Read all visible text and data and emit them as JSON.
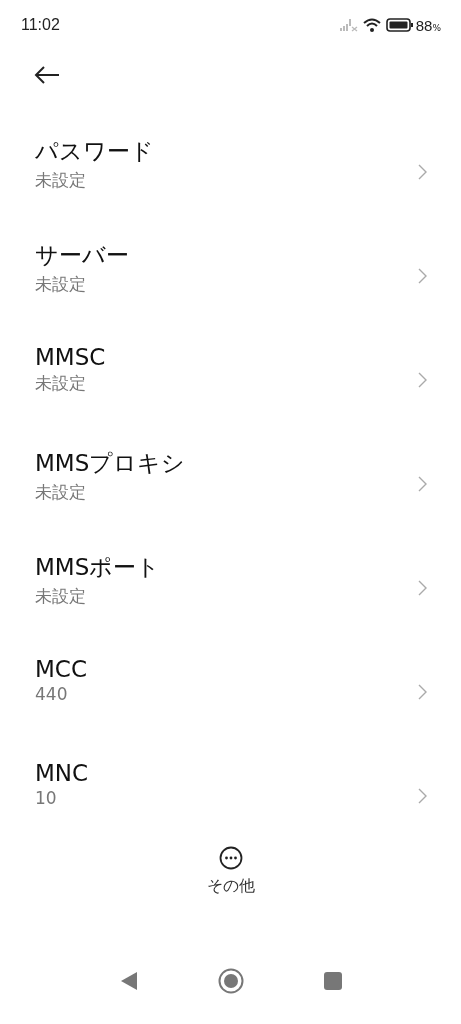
{
  "status_bar": {
    "time": "11:02",
    "battery": "88",
    "battery_unit": "%"
  },
  "items": [
    {
      "title": "パスワード",
      "value": "未設定"
    },
    {
      "title": "サーバー",
      "value": "未設定"
    },
    {
      "title": "MMSC",
      "value": "未設定"
    },
    {
      "title": "MMSプロキシ",
      "value": "未設定"
    },
    {
      "title": "MMSポート",
      "value": "未設定"
    },
    {
      "title": "MCC",
      "value": "440"
    },
    {
      "title": "MNC",
      "value": "10"
    }
  ],
  "bottom_action": {
    "label": "その他"
  }
}
